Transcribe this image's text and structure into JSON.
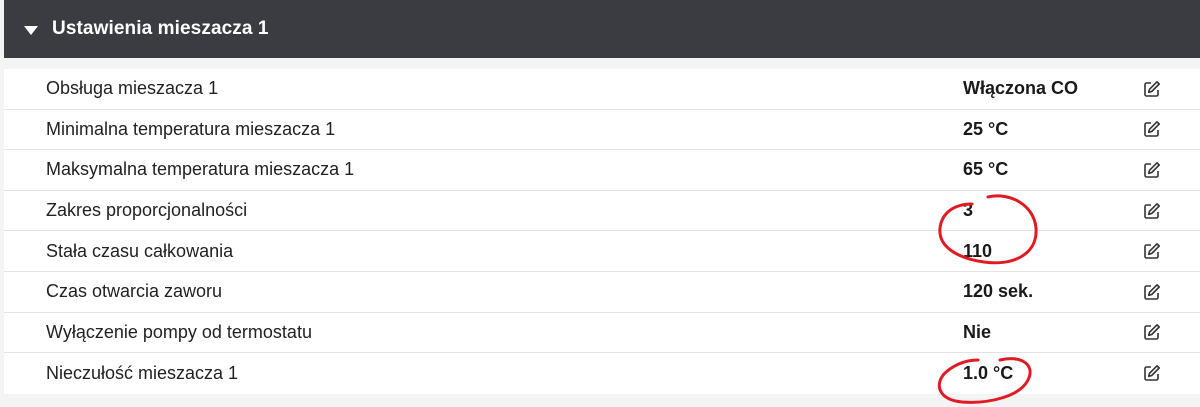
{
  "section": {
    "title": "Ustawienia mieszacza 1",
    "expanded": true
  },
  "rows": [
    {
      "label": "Obsługa mieszacza 1",
      "value": "Włączona CO"
    },
    {
      "label": "Minimalna temperatura mieszacza 1",
      "value": "25 °C"
    },
    {
      "label": "Maksymalna temperatura mieszacza 1",
      "value": "65 °C"
    },
    {
      "label": "Zakres proporcjonalności",
      "value": "3"
    },
    {
      "label": "Stała czasu całkowania",
      "value": "110"
    },
    {
      "label": "Czas otwarcia zaworu",
      "value": "120 sek."
    },
    {
      "label": "Wyłączenie pompy od termostatu",
      "value": "Nie"
    },
    {
      "label": "Nieczułość mieszacza 1",
      "value": "1.0 °C"
    }
  ],
  "colors": {
    "header_bg": "#3a3c42",
    "annotation": "#e01b24"
  }
}
